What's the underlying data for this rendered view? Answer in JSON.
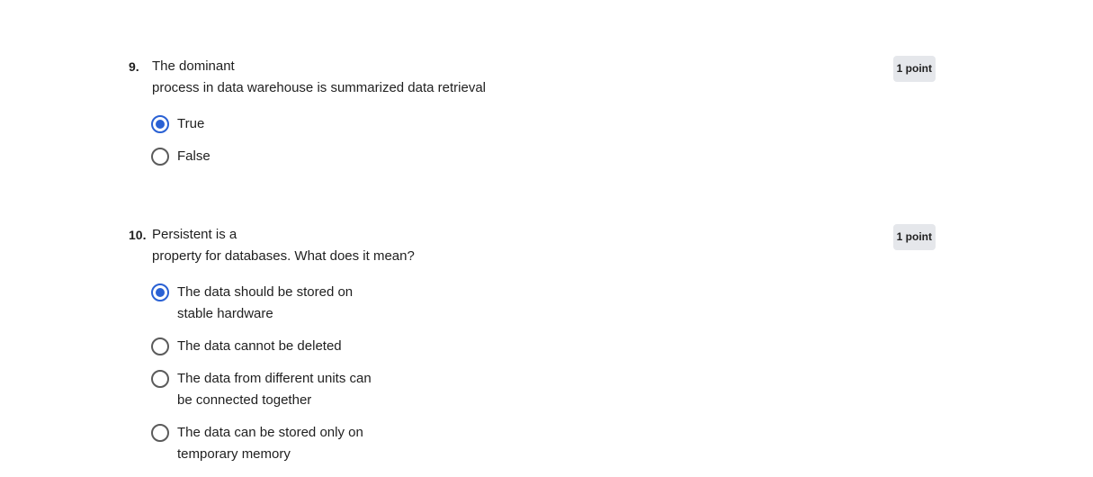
{
  "questions": [
    {
      "number": "9.",
      "text": "The dominant\nprocess in data warehouse is summarized data retrieval",
      "points": "1 point",
      "options": [
        {
          "label": "True",
          "selected": true
        },
        {
          "label": "False",
          "selected": false
        }
      ]
    },
    {
      "number": "10.",
      "text": "Persistent is a\nproperty for databases. What does it mean?",
      "points": "1 point",
      "options": [
        {
          "label": "The data should be stored on\nstable hardware",
          "selected": true
        },
        {
          "label": "The data cannot be deleted",
          "selected": false
        },
        {
          "label": "The data from different units can\nbe connected together",
          "selected": false
        },
        {
          "label": "The data can be stored only on\ntemporary memory",
          "selected": false
        }
      ]
    }
  ],
  "colors": {
    "accent": "#2a61d4",
    "badge_bg": "#e5e7eb"
  }
}
